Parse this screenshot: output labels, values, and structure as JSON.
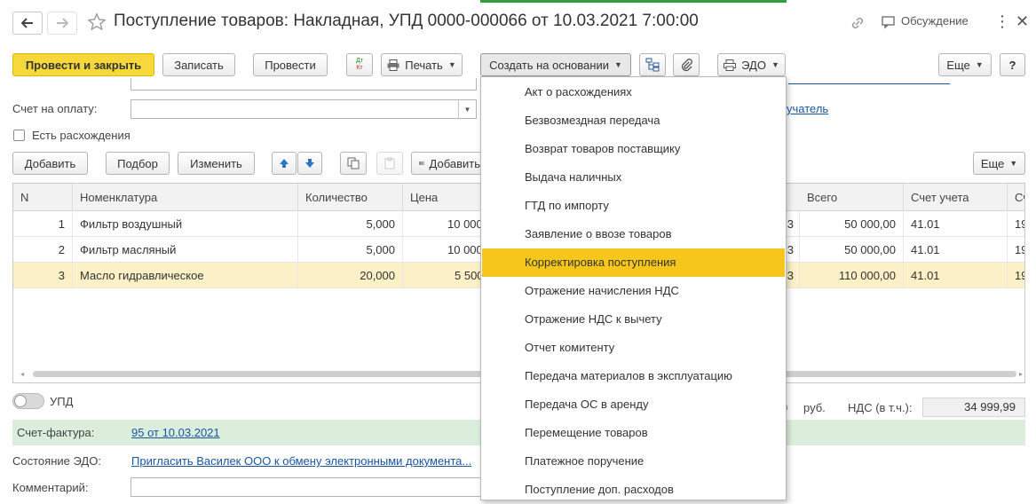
{
  "window": {
    "title": "Поступление товаров: Накладная, УПД 0000-000066 от 10.03.2021 7:00:00",
    "discussion_label": "Обсуждение"
  },
  "toolbar": {
    "post_and_close": "Провести и закрыть",
    "save": "Записать",
    "post": "Провести",
    "dtkt_top": "Дт",
    "dtkt_bottom": "Кт",
    "print": "Печать",
    "create_based_on": "Создать на основании",
    "edo": "ЭДО",
    "more": "Еще",
    "help": "?"
  },
  "form": {
    "invoice_label": "Счет на оплату:",
    "recipient_link_fragment": "учатель",
    "discrepancies_label": "Есть расхождения",
    "discrepancies_checked": false
  },
  "table_toolbar": {
    "add": "Добавить",
    "pick": "Подбор",
    "change": "Изменить",
    "add_barcode": "Добавить",
    "more": "Еще"
  },
  "table": {
    "columns": {
      "n": "N",
      "item": "Номенклатура",
      "qty": "Количество",
      "price": "Цена",
      "total": "Всего",
      "account": "Счет учета",
      "extra": "Сч"
    },
    "rows": [
      {
        "n": "1",
        "item": "Фильтр воздушный",
        "qty": "5,000",
        "price": "10 000",
        "vat_frag": "3",
        "total": "50 000,00",
        "account": "41.01",
        "extra": "19"
      },
      {
        "n": "2",
        "item": "Фильтр масляный",
        "qty": "5,000",
        "price": "10 000",
        "vat_frag": "3",
        "total": "50 000,00",
        "account": "41.01",
        "extra": "19"
      },
      {
        "n": "3",
        "item": "Масло гидравлическое",
        "qty": "20,000",
        "price": "5 500",
        "vat_frag": "3",
        "total": "110 000,00",
        "account": "41.01",
        "extra": "19"
      }
    ]
  },
  "footer": {
    "upd_label": "УПД",
    "upd_on": false,
    "total_frag": "0",
    "currency": "руб.",
    "vat_label": "НДС (в т.ч.):",
    "vat_value": "34 999,99",
    "invoice_label": "Счет-фактура:",
    "invoice_link": "95 от 10.03.2021",
    "edo_state_label": "Состояние ЭДО:",
    "edo_state_link": "Пригласить Василек ООО к обмену электронными документа...",
    "comment_label": "Комментарий:",
    "comment_value": ""
  },
  "menu": {
    "items": [
      "Акт о расхождениях",
      "Безвозмездная передача",
      "Возврат товаров поставщику",
      "Выдача наличных",
      "ГТД по импорту",
      "Заявление о ввозе товаров",
      "Корректировка поступления",
      "Отражение начисления НДС",
      "Отражение НДС к вычету",
      "Отчет комитенту",
      "Передача материалов в эксплуатацию",
      "Передача ОС в аренду",
      "Перемещение товаров",
      "Платежное поручение",
      "Поступление доп. расходов"
    ],
    "highlighted_index": 6
  },
  "colors": {
    "primary_button": "#f7d83a",
    "menu_highlight": "#f6c61c",
    "selected_row": "#fbf0c6",
    "invoice_bar": "#dbeedc",
    "link": "#1a55a0"
  }
}
